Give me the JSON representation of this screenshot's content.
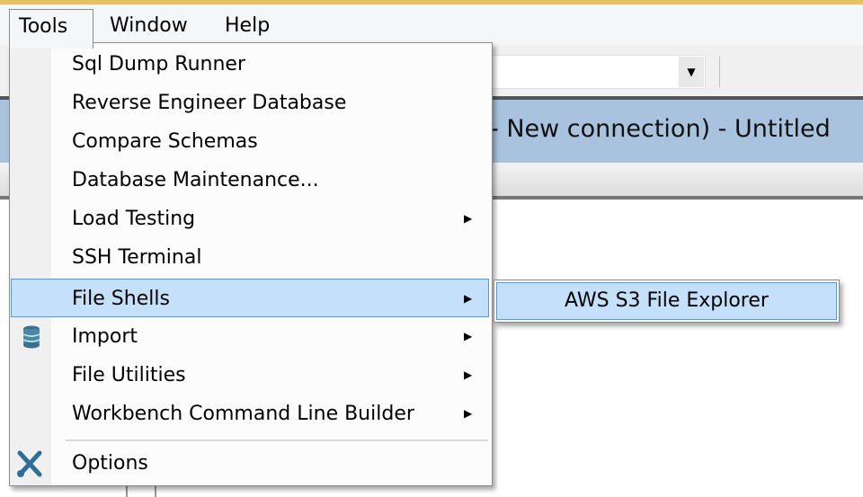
{
  "menubar": {
    "items": [
      {
        "label": "Tools"
      },
      {
        "label": "Window"
      },
      {
        "label": "Help"
      }
    ]
  },
  "window": {
    "title_fragment": "- New connection) - Untitled"
  },
  "tools_menu": {
    "items": [
      {
        "label": "Sql Dump Runner",
        "submenu": false
      },
      {
        "label": "Reverse Engineer Database",
        "submenu": false
      },
      {
        "label": "Compare Schemas",
        "submenu": false
      },
      {
        "label": "Database Maintenance...",
        "submenu": false
      },
      {
        "label": "Load Testing",
        "submenu": true
      },
      {
        "label": "SSH Terminal",
        "submenu": false
      },
      {
        "label": "File Shells",
        "submenu": true,
        "highlighted": true
      },
      {
        "label": "Import",
        "submenu": true,
        "icon": "database-icon"
      },
      {
        "label": "File Utilities",
        "submenu": true
      },
      {
        "label": "Workbench Command Line Builder",
        "submenu": true
      },
      {
        "label": "Options",
        "submenu": false,
        "icon": "wrench-screwdriver-icon"
      }
    ],
    "arrow": "▶"
  },
  "file_shells_submenu": {
    "items": [
      {
        "label": "AWS S3 File Explorer",
        "highlighted": true
      }
    ]
  },
  "toolbar": {
    "dropdown_arrow": "▼"
  },
  "colors": {
    "highlight": "#c5e0fa",
    "highlight_border": "#4d9be8",
    "titlebar": "#a9c3df"
  }
}
